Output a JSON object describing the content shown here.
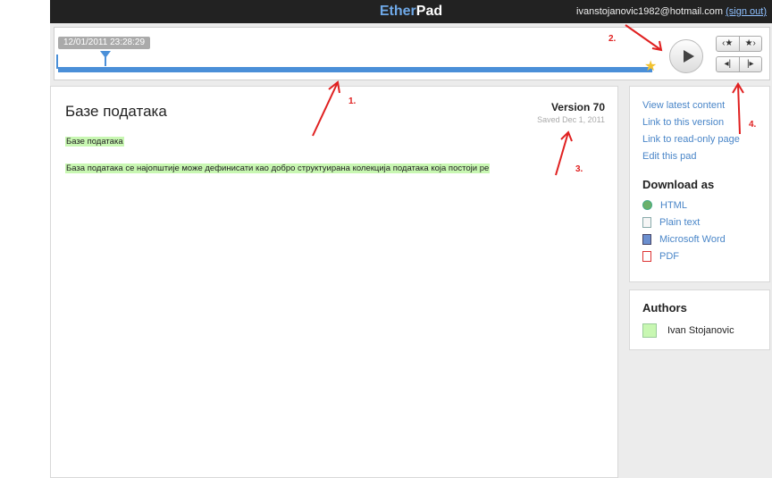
{
  "header": {
    "brand_part1": "Ether",
    "brand_part2": "Pad",
    "user_email": "ivanstojanovic1982@hotmail.com",
    "signout_label": "(sign out)"
  },
  "timeslider": {
    "timestamp": "12/01/2011 23:28:29",
    "position_percent": 8,
    "star_buttons": [
      "‹★",
      "★›"
    ],
    "step_buttons": [
      "◂|",
      "|▸"
    ]
  },
  "document": {
    "title": "Базе података",
    "version": "Version 70",
    "saved": "Saved Dec 1, 2011",
    "lines": [
      "Базе података",
      "База података се најопштије може дефинисати као добро структуирана колекција података која постоји ре"
    ]
  },
  "links": [
    "View latest content",
    "Link to this version",
    "Link to read-only page",
    "Edit this pad"
  ],
  "download": {
    "heading": "Download as",
    "items": [
      {
        "label": "HTML",
        "icon": "html-icon"
      },
      {
        "label": "Plain text",
        "icon": "text-file-icon"
      },
      {
        "label": "Microsoft Word",
        "icon": "word-icon"
      },
      {
        "label": "PDF",
        "icon": "pdf-icon"
      }
    ]
  },
  "authors": {
    "heading": "Authors",
    "list": [
      {
        "name": "Ivan Stojanovic",
        "color": "#c8f7b2"
      }
    ]
  },
  "annotations": [
    "1.",
    "2.",
    "3.",
    "4."
  ],
  "colors": {
    "annotation": "#e02020",
    "link": "#4a86c8",
    "slider": "#4a8fd8",
    "highlight": "#c8f7b2",
    "topbar": "#222222"
  }
}
